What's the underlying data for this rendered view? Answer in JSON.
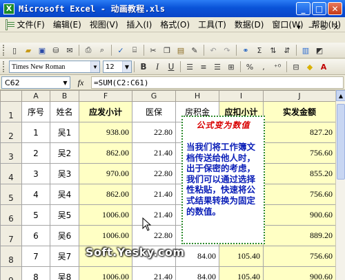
{
  "window": {
    "title": "Microsoft Excel - 动画教程.xls",
    "app_icon": "X"
  },
  "menu": {
    "items": [
      "文件(F)",
      "编辑(E)",
      "视图(V)",
      "插入(I)",
      "格式(O)",
      "工具(T)",
      "数据(D)",
      "窗口(W)",
      "帮助(H)"
    ],
    "right_controls": [
      "▾",
      "−",
      "▫",
      "×"
    ]
  },
  "format_toolbar": {
    "font_name": "Times New Roman",
    "font_size": "12",
    "bold": "B",
    "italic": "I",
    "underline": "U"
  },
  "formula_bar": {
    "name_box": "C62",
    "fx": "fx",
    "formula": "=SUM(C2:C61)"
  },
  "sheet": {
    "columns": [
      "A",
      "B",
      "F",
      "G",
      "H",
      "I",
      "J"
    ],
    "header_row": {
      "row_label": "1",
      "cells": [
        "序号",
        "姓名",
        "应发小计",
        "医保",
        "房积金",
        "应扣小计",
        "实发金额"
      ]
    },
    "rows": [
      {
        "row_label": "2",
        "seq": "1",
        "name": "吴1",
        "gross": "938.00",
        "medical": "22.80",
        "housing": "",
        "deduct": "",
        "net": "827.20"
      },
      {
        "row_label": "3",
        "seq": "2",
        "name": "吴2",
        "gross": "862.00",
        "medical": "21.40",
        "housing": "",
        "deduct": "",
        "net": "756.60"
      },
      {
        "row_label": "4",
        "seq": "3",
        "name": "吴3",
        "gross": "970.00",
        "medical": "22.80",
        "housing": "",
        "deduct": "",
        "net": "855.20"
      },
      {
        "row_label": "5",
        "seq": "4",
        "name": "吴4",
        "gross": "862.00",
        "medical": "21.40",
        "housing": "",
        "deduct": "",
        "net": "756.60"
      },
      {
        "row_label": "6",
        "seq": "5",
        "name": "吴5",
        "gross": "1006.00",
        "medical": "21.40",
        "housing": "",
        "deduct": "",
        "net": "900.60"
      },
      {
        "row_label": "7",
        "seq": "6",
        "name": "吴6",
        "gross": "1006.00",
        "medical": "22.80",
        "housing": "",
        "deduct": "",
        "net": "889.20"
      },
      {
        "row_label": "8",
        "seq": "7",
        "name": "吴7",
        "gross": "",
        "medical": "",
        "housing": "84.00",
        "deduct": "105.40",
        "net": "756.60"
      },
      {
        "row_label": "9",
        "seq": "8",
        "name": "吴8",
        "gross": "1006.00",
        "medical": "21.40",
        "housing": "84.00",
        "deduct": "105.40",
        "net": "900.60"
      }
    ]
  },
  "note": {
    "title": "公式变为数值",
    "body": "当我们将工作簿文档传送给他人时，出于保密的考虑，我们可以通过选择性粘贴，快速将公式结果转换为固定的数值。"
  },
  "watermark": "Soft.Yesky.com"
}
